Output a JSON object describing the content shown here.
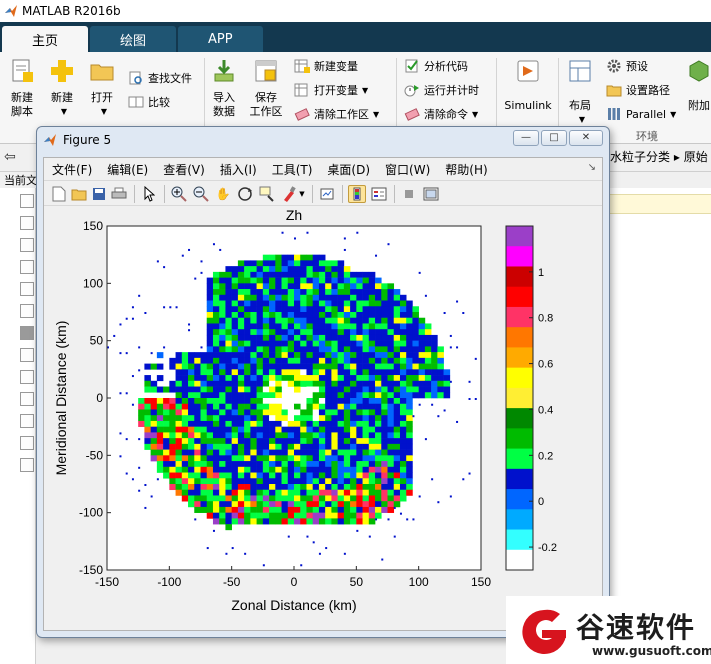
{
  "app": {
    "title": "MATLAB R2016b"
  },
  "tabs": [
    {
      "label": "主页",
      "active": true
    },
    {
      "label": "绘图",
      "active": false
    },
    {
      "label": "APP",
      "active": false
    }
  ],
  "ribbon": {
    "new_script": "新建\n脚本",
    "new": "新建",
    "open": "打开",
    "find_files": "查找文件",
    "compare": "比较",
    "import_data": "导入\n数据",
    "save_workspace": "保存\n工作区",
    "new_variable": "新建变量",
    "open_variable": "打开变量",
    "clear_workspace": "清除工作区",
    "analyze_code": "分析代码",
    "run_and_time": "运行并计时",
    "clear_commands": "清除命令",
    "simulink": "Simulink",
    "layout": "布局",
    "preferences": "预设",
    "set_path": "设置路径",
    "parallel": "Parallel",
    "addons": "附加",
    "environment_group": "环境"
  },
  "nav": {
    "current_folder": "当前文",
    "path_part1": "水粒子分类",
    "path_part2": "原始"
  },
  "figure": {
    "window_title": "Figure 5",
    "window_buttons": {
      "minimize": "—",
      "maximize": "□",
      "close": "✕"
    },
    "menu": [
      "文件(F)",
      "编辑(E)",
      "查看(V)",
      "插入(I)",
      "工具(T)",
      "桌面(D)",
      "窗口(W)",
      "帮助(H)"
    ]
  },
  "chart_data": {
    "type": "heatmap",
    "title": "Zh",
    "xlabel": "Zonal Distance (km)",
    "ylabel": "Meridional Distance (km)",
    "xlim": [
      -150,
      150
    ],
    "ylim": [
      -150,
      150
    ],
    "xticks": [
      "-150",
      "-100",
      "-50",
      "0",
      "50",
      "100",
      "150"
    ],
    "yticks": [
      "150",
      "100",
      "50",
      "0",
      "-50",
      "-100",
      "-150"
    ],
    "colorbar": {
      "range": [
        -0.3,
        1.2
      ],
      "ticks": [
        "1",
        "0.8",
        "0.6",
        "0.4",
        "0.2",
        "0",
        "-0.2"
      ],
      "colors_top_to_bottom": [
        "#9b3fc8",
        "#ff00ff",
        "#cc0000",
        "#ff0000",
        "#ff3366",
        "#ff7700",
        "#ffaa00",
        "#ffff00",
        "#ffee33",
        "#008800",
        "#00bb00",
        "#00ff44",
        "#0011cc",
        "#0066ff",
        "#00aaff",
        "#33ffff",
        "#ffffff"
      ]
    }
  },
  "watermark": {
    "name": "谷速软件",
    "url": "www.gusuoft.com"
  }
}
